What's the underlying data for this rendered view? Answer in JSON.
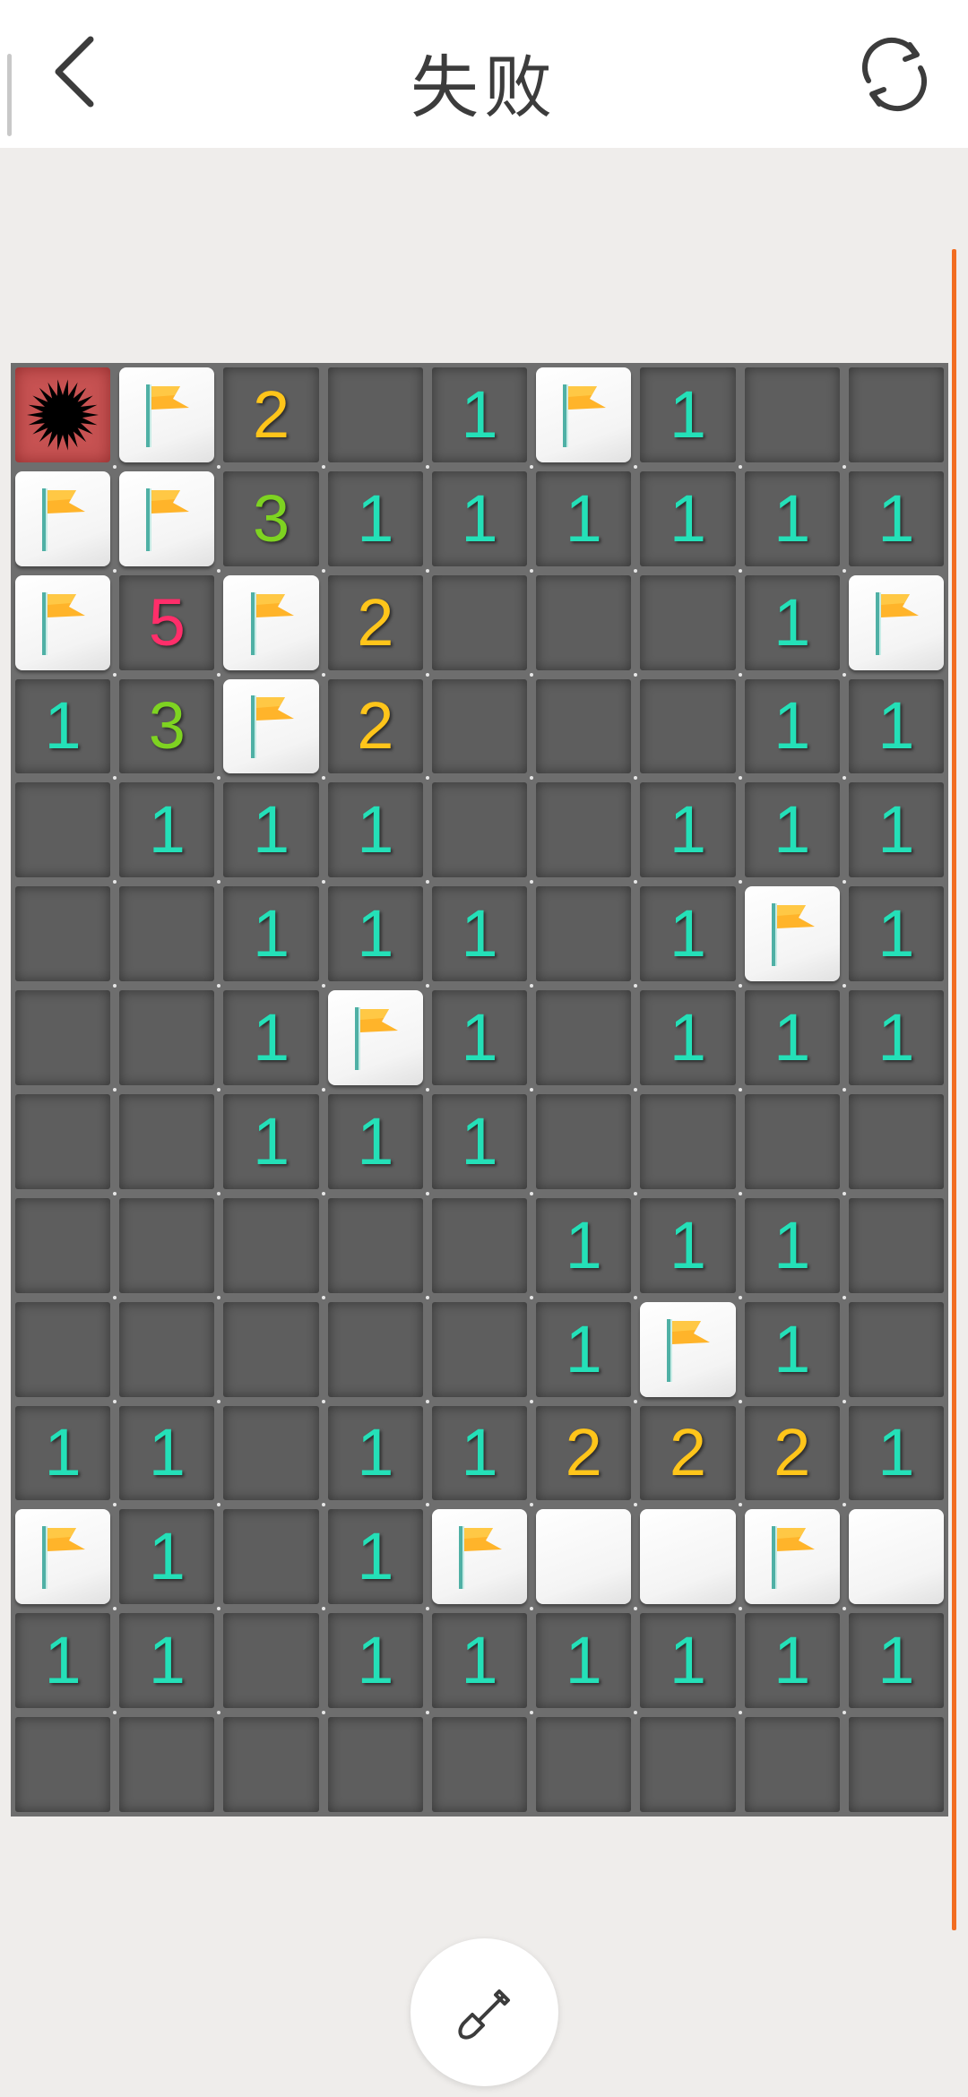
{
  "header": {
    "title": "失败",
    "back_icon": "chevron-left-icon",
    "refresh_icon": "refresh-icon"
  },
  "colors": {
    "n1": "#24e0b8",
    "n2": "#ffc51a",
    "n3": "#7ed321",
    "n5": "#ff2e6a",
    "board": "#6e6e6e",
    "accent": "#f26d21"
  },
  "board": {
    "cols": 9,
    "rows": 14,
    "grid": [
      [
        "M",
        "F",
        "2",
        ".",
        "1",
        "F",
        "1",
        ".",
        "."
      ],
      [
        "F",
        "F",
        "3",
        "1",
        "1",
        "1",
        "1",
        "1",
        "1"
      ],
      [
        "F",
        "5",
        "F",
        "2",
        ".",
        ".",
        ".",
        "1",
        "F"
      ],
      [
        "1",
        "3",
        "F",
        "2",
        ".",
        ".",
        ".",
        "1",
        "1"
      ],
      [
        ".",
        "1",
        "1",
        "1",
        ".",
        ".",
        "1",
        "1",
        "1"
      ],
      [
        ".",
        ".",
        "1",
        "1",
        "1",
        ".",
        "1",
        "F",
        "1"
      ],
      [
        ".",
        ".",
        "1",
        "F",
        "1",
        ".",
        "1",
        "1",
        "1"
      ],
      [
        ".",
        ".",
        "1",
        "1",
        "1",
        ".",
        ".",
        ".",
        "."
      ],
      [
        ".",
        ".",
        ".",
        ".",
        ".",
        "1",
        "1",
        "1",
        "."
      ],
      [
        ".",
        ".",
        ".",
        ".",
        ".",
        "1",
        "F",
        "1",
        "."
      ],
      [
        "1",
        "1",
        ".",
        "1",
        "1",
        "2",
        "2",
        "2",
        "1"
      ],
      [
        "F",
        "1",
        ".",
        "1",
        "F",
        "C",
        "C",
        "F",
        "C"
      ],
      [
        "1",
        "1",
        ".",
        "1",
        "1",
        "1",
        "1",
        "1",
        "1"
      ],
      [
        ".",
        ".",
        ".",
        ".",
        ".",
        ".",
        ".",
        ".",
        "."
      ]
    ]
  },
  "tool": {
    "icon": "shovel-icon"
  }
}
